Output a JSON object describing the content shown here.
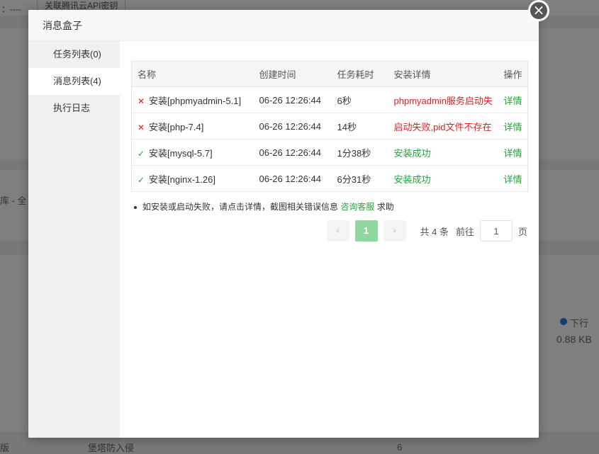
{
  "background": {
    "top_label": "：----",
    "top_button": "关联腾讯云API密钥",
    "side_text": "库 - 全",
    "legend_label": "下行",
    "legend_value": "0.88 KB",
    "bottom_left_text": "版",
    "bottom_mid_text": "堡塔防入侵",
    "bottom_right_text": "6"
  },
  "dialog": {
    "title": "消息盒子",
    "close_glyph": "×"
  },
  "sidebar": {
    "items": [
      {
        "label": "任务列表(0)"
      },
      {
        "label": "消息列表(4)"
      },
      {
        "label": "执行日志"
      }
    ]
  },
  "table": {
    "headers": [
      "名称",
      "创建时间",
      "任务耗时",
      "安装详情",
      "操作"
    ],
    "rows": [
      {
        "status": "fail",
        "status_icon": "✕",
        "name": "安装[phpmyadmin-5.1]",
        "time": "06-26 12:26:44",
        "duration": "6秒",
        "detail": "phpmyadmin服务启动失",
        "action": "详情"
      },
      {
        "status": "fail",
        "status_icon": "✕",
        "name": "安装[php-7.4]",
        "time": "06-26 12:26:44",
        "duration": "14秒",
        "detail": "启动失败,pid文件不存在",
        "action": "详情"
      },
      {
        "status": "ok",
        "status_icon": "✓",
        "name": "安装[mysql-5.7]",
        "time": "06-26 12:26:44",
        "duration": "1分38秒",
        "detail": "安装成功",
        "action": "详情"
      },
      {
        "status": "ok",
        "status_icon": "✓",
        "name": "安装[nginx-1.26]",
        "time": "06-26 12:26:44",
        "duration": "6分31秒",
        "detail": "安装成功",
        "action": "详情"
      }
    ]
  },
  "tip": {
    "text": "如安装或启动失败，请点击详情，截图相关错误信息",
    "link": "咨询客服",
    "suffix": "求助"
  },
  "pagination": {
    "prev": "‹",
    "current": "1",
    "next": "›",
    "total": "共 4 条",
    "goto_label": "前往",
    "goto_value": "1",
    "page_unit": "页"
  },
  "colors": {
    "accent": "#20a53a",
    "error": "#e02020"
  }
}
